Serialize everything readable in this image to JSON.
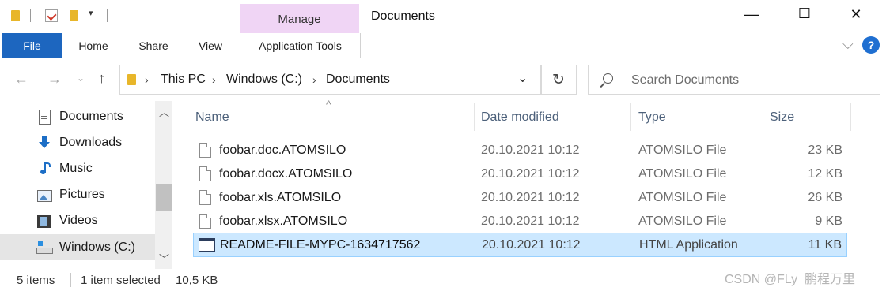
{
  "window": {
    "title": "Documents",
    "minimize": "—",
    "maximize": "☐",
    "close": "✕"
  },
  "ribbon": {
    "contextual_group": "Manage",
    "tabs": [
      "File",
      "Home",
      "Share",
      "View",
      "Application Tools"
    ],
    "collapse_glyph": "⌵",
    "help": "?"
  },
  "address": {
    "crumbs": [
      "This PC",
      "Windows (C:)",
      "Documents"
    ]
  },
  "search": {
    "placeholder": "Search Documents"
  },
  "nav": {
    "items": [
      {
        "label": "Documents",
        "icon": "documents-icon"
      },
      {
        "label": "Downloads",
        "icon": "downloads-icon"
      },
      {
        "label": "Music",
        "icon": "music-icon"
      },
      {
        "label": "Pictures",
        "icon": "pictures-icon"
      },
      {
        "label": "Videos",
        "icon": "videos-icon"
      },
      {
        "label": "Windows (C:)",
        "icon": "drive-icon",
        "selected": true
      }
    ]
  },
  "list": {
    "columns": {
      "name": "Name",
      "date": "Date modified",
      "type": "Type",
      "size": "Size"
    },
    "sort_glyph": "^",
    "rows": [
      {
        "name": "foobar.doc.ATOMSILO",
        "date": "20.10.2021 10:12",
        "type": "ATOMSILO File",
        "size": "23 KB"
      },
      {
        "name": "foobar.docx.ATOMSILO",
        "date": "20.10.2021 10:12",
        "type": "ATOMSILO File",
        "size": "12 KB"
      },
      {
        "name": "foobar.xls.ATOMSILO",
        "date": "20.10.2021 10:12",
        "type": "ATOMSILO File",
        "size": "26 KB"
      },
      {
        "name": "foobar.xlsx.ATOMSILO",
        "date": "20.10.2021 10:12",
        "type": "ATOMSILO File",
        "size": "9 KB"
      },
      {
        "name": "README-FILE-MYPC-1634717562",
        "date": "20.10.2021 10:12",
        "type": "HTML Application",
        "size": "11 KB",
        "selected": true
      }
    ]
  },
  "status": {
    "item_count": "5 items",
    "selection": "1 item selected",
    "selection_size": "10,5 KB"
  },
  "watermark": "CSDN @FLy_鹏程万里",
  "colors": {
    "accent": "#1d66bf",
    "manage_tab": "#f0d5f5",
    "selection": "#cce8ff",
    "selection_border": "#99d1ff"
  }
}
